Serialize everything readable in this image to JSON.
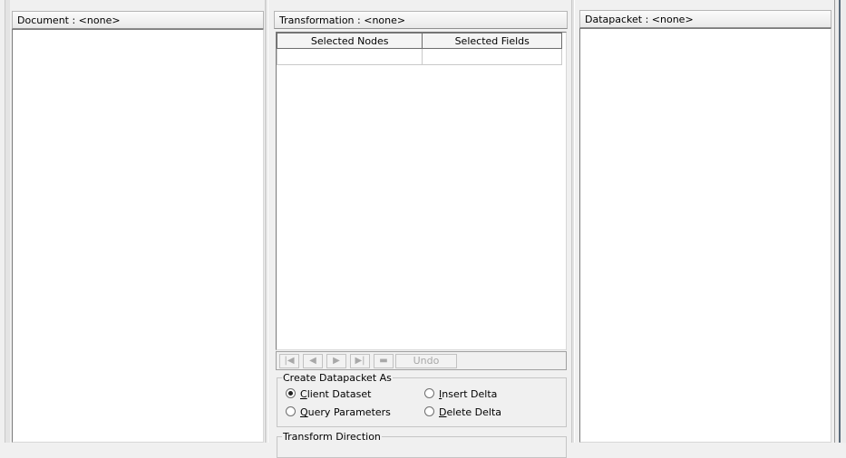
{
  "document_panel": {
    "title": "Document : <none>"
  },
  "transformation_panel": {
    "title": "Transformation : <none>",
    "grid": {
      "columns": [
        "Selected Nodes",
        "Selected Fields"
      ],
      "rows": [
        [
          "",
          ""
        ]
      ]
    },
    "navigator": {
      "first_icon": "first-record-icon",
      "prior_icon": "prior-record-icon",
      "next_icon": "next-record-icon",
      "last_icon": "last-record-icon",
      "delete_icon": "delete-record-icon",
      "undo_label": "Undo"
    },
    "create_as": {
      "legend": "Create Datapacket As",
      "options": [
        {
          "accel": "C",
          "rest": "lient Dataset",
          "checked": true
        },
        {
          "accel": "I",
          "rest": "nsert Delta",
          "checked": false
        },
        {
          "accel": "Q",
          "rest": "uery Parameters",
          "checked": false
        },
        {
          "accel": "D",
          "rest": "elete Delta",
          "checked": false
        }
      ]
    },
    "direction": {
      "legend": "Transform Direction"
    }
  },
  "datapacket_panel": {
    "title": "Datapacket : <none>"
  }
}
